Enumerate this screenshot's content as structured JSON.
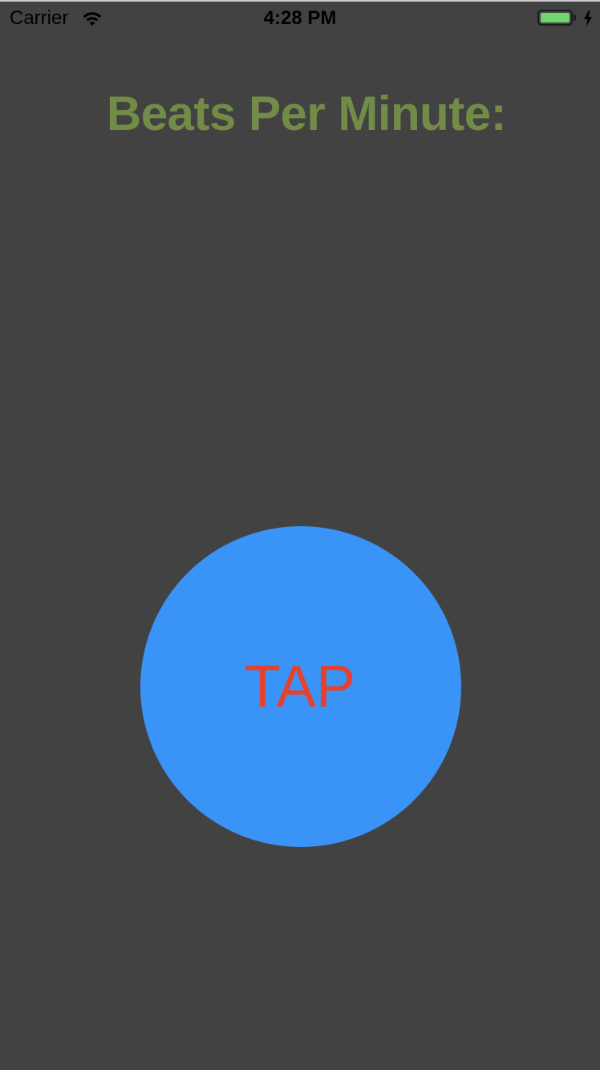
{
  "status_bar": {
    "carrier": "Carrier",
    "time": "4:28 PM",
    "wifi_icon": "wifi-icon",
    "battery_icon": "battery-icon",
    "charging_icon": "lightning-bolt-icon",
    "battery_level": 1.0,
    "battery_color": "#6fd56f"
  },
  "main": {
    "title": "Beats Per Minute:",
    "title_color": "#728b47",
    "tap_button_label": "TAP",
    "tap_button_color": "#3a94f7",
    "tap_label_color": "#e4412e",
    "background_color": "#424242"
  }
}
